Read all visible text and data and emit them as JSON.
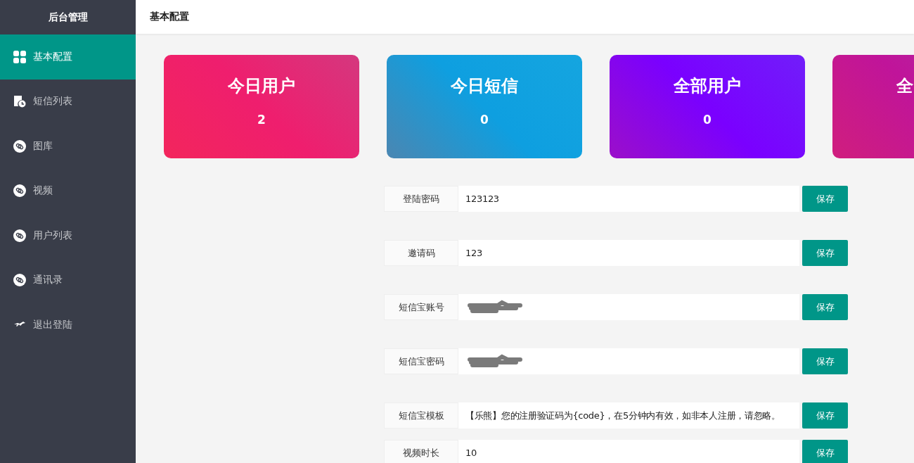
{
  "sidebar": {
    "title": "后台管理",
    "items": [
      {
        "label": "基本配置",
        "kind": "grid",
        "selected": true
      },
      {
        "label": "短信列表",
        "kind": "schedule",
        "selected": false
      },
      {
        "label": "图库",
        "kind": "link",
        "selected": false
      },
      {
        "label": "视频",
        "kind": "link",
        "selected": false
      },
      {
        "label": "用户列表",
        "kind": "link",
        "selected": false
      },
      {
        "label": "通讯录",
        "kind": "link",
        "selected": false
      },
      {
        "label": "退出登陆",
        "kind": "exit",
        "selected": false
      }
    ]
  },
  "header": {
    "title": "基本配置"
  },
  "stat_cards": [
    {
      "title": "今日用户",
      "value": "2",
      "color": "#ef1e6e"
    },
    {
      "title": "今日短信",
      "value": "0",
      "color": "#0e9fe0"
    },
    {
      "title": "全部用户",
      "value": "0",
      "color": "#7a00ff"
    },
    {
      "title": "全",
      "color": "#c0149a"
    }
  ],
  "settings": [
    {
      "label": "登陆密码",
      "kind": "text",
      "value": "123123",
      "button": "保存"
    },
    {
      "label": "邀请码",
      "kind": "text",
      "value": "123",
      "button": "保存"
    },
    {
      "label": "短信宝账号",
      "kind": "redacted",
      "button": "保存"
    },
    {
      "label": "短信宝密码",
      "kind": "redacted",
      "button": "保存"
    },
    {
      "label": "短信宝模板",
      "kind": "text",
      "value": "【乐熊】您的注册验证码为{code}，在5分钟内有效，如非本人注册，请忽略。",
      "button": "保存"
    },
    {
      "label": "视频时长",
      "kind": "text",
      "value": "10",
      "button": "保存"
    }
  ]
}
